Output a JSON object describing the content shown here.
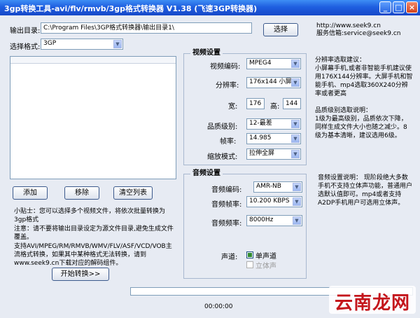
{
  "window": {
    "title": "3gp转换工具-avi/flv/rmvb/3gp格式转换器 V1.38 (飞速3GP转换器)",
    "min_glyph": "_",
    "max_glyph": "□",
    "close_glyph": "×"
  },
  "top": {
    "output_label": "输出目录:",
    "output_value": "C:\\Program Files\\3GP格式转换器\\输出目录1\\",
    "browse_label": "选择",
    "website": "http://www.seek9.cn",
    "service_email": "服务信箱:service@seek9.cn",
    "format_label": "选择格式:",
    "format_value": "3GP"
  },
  "video": {
    "title": "视频设置",
    "codec_label": "视频编码:",
    "codec_value": "MPEG4",
    "resolution_label": "分辨率:",
    "resolution_value": "176x144 小屏",
    "width_label": "宽:",
    "width_value": "176",
    "height_label": "高:",
    "height_value": "144",
    "quality_label": "品质级别:",
    "quality_value": "12-最差",
    "framerate_label": "帧率:",
    "framerate_value": "14.985",
    "scale_label": "缩放模式:",
    "scale_value": "拉伸全屏"
  },
  "audio": {
    "title": "音频设置",
    "codec_label": "音频编码:",
    "codec_value": "AMR-NB",
    "rate_label": "音频帧率:",
    "rate_value": "10.200 KBPS",
    "freq_label": "音频频率:",
    "freq_value": "8000Hz",
    "channel_label": "声道:",
    "mono_label": "单声道",
    "stereo_label": "立体声"
  },
  "notes": {
    "resolution_advice": "分辨率选取建议：\n小屏幕手机,或者非智能手机建议使用176X144分辨率。大屏手机和智能手机、mp4选取360X240分辨率或者更高",
    "quality_advice": "品质级别选取说明：\n1级为最高级别，品质依次下降，同样生成文件大小也随之减少。8级为基本清晰，建议选用6级。",
    "audio_advice": "音频设置说明：   现阶段绝大多数手机不支持立体声功能，普通用户选默认值即可。mp4或者支持A2DP手机用户可选用立体声。"
  },
  "actions": {
    "add_label": "添加",
    "remove_label": "移除",
    "clear_label": "清空列表",
    "start_label": "开始转换>>"
  },
  "tips": {
    "tip1": "小贴士：您可以选择多个视频文件，将依次批量转换为3gp格式",
    "tip2": "注意：请不要将输出目录设定为源文件目录,避免生成文件覆盖。",
    "tip3": "支持AVI/MPEG/RM/RMVB/WMV/FLV/ASF/VCD/VOB主流格式转换，如果其中某种格式无法转换，请到www.seek9.cn下载对应的解码组件。"
  },
  "status": {
    "time": "00:00:00"
  },
  "watermark": {
    "text": "云南龙网"
  },
  "colors": {
    "title_bar": "#1f5fe0",
    "background": "#e7ebf3",
    "watermark_red": "#c4161c"
  }
}
